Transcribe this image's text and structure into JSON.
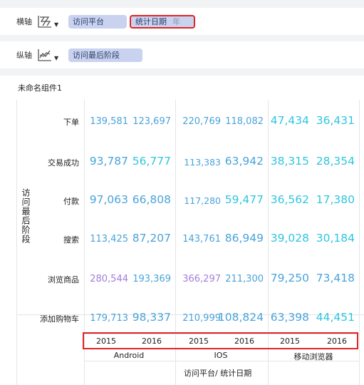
{
  "toolbar": {
    "horizontal_axis": {
      "label": "横轴",
      "fields": [
        "访问平台",
        "统计日期"
      ],
      "date_unit": "年"
    },
    "vertical_axis": {
      "label": "纵轴",
      "fields": [
        "访问最后阶段"
      ]
    }
  },
  "component": {
    "title": "未命名组件1",
    "vertical_axis_title": "访问最后阶段",
    "horizontal_axis_title": "访问平台/ 统计日期",
    "rows": [
      "下单",
      "交易成功",
      "付款",
      "搜索",
      "浏览商品",
      "添加购物车"
    ],
    "platforms": [
      "Android",
      "IOS",
      "移动浏览器"
    ],
    "years": [
      "2015",
      "2016",
      "2015",
      "2016",
      "2015",
      "2016"
    ],
    "values": [
      [
        "139,581",
        "123,697",
        "220,769",
        "118,082",
        "47,434",
        "36,431"
      ],
      [
        "93,787",
        "56,777",
        "113,383",
        "63,942",
        "38,315",
        "28,354"
      ],
      [
        "97,063",
        "66,808",
        "117,280",
        "59,477",
        "36,562",
        "17,380"
      ],
      [
        "113,425",
        "87,207",
        "143,761",
        "86,949",
        "39,028",
        "30,184"
      ],
      [
        "280,544",
        "193,369",
        "366,297",
        "211,300",
        "79,250",
        "73,418"
      ],
      [
        "179,713",
        "98,337",
        "210,999",
        "108,824",
        "63,398",
        "44,451"
      ]
    ],
    "colors": {
      "accent": "#4aa3d9",
      "cyan": "#2fc6de",
      "purple": "#a37ddc",
      "highlight": "#e02424"
    }
  }
}
